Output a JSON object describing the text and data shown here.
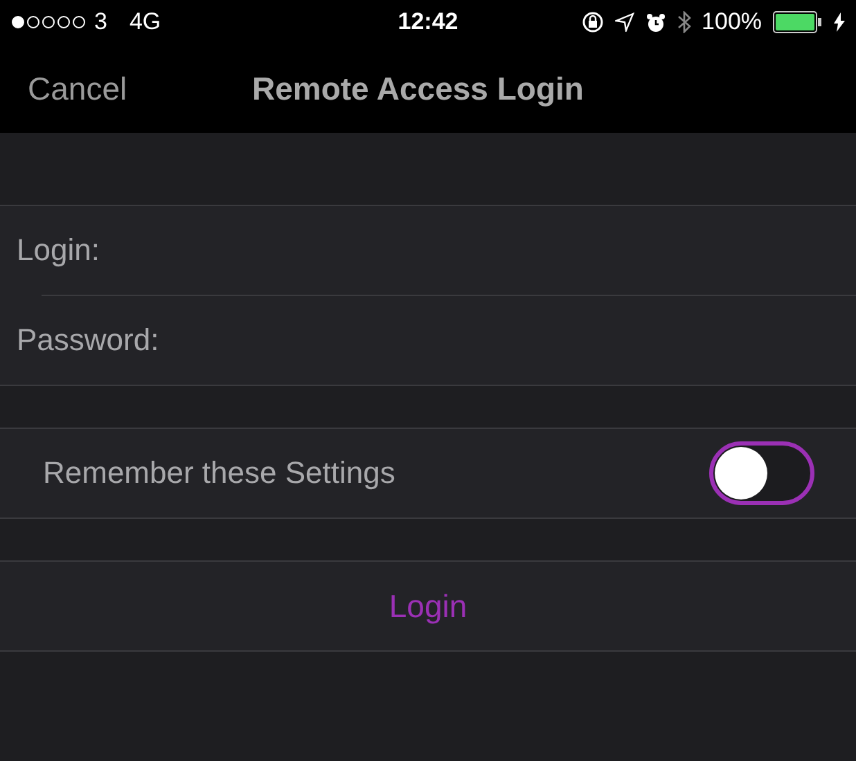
{
  "status_bar": {
    "carrier": "3",
    "network": "4G",
    "time": "12:42",
    "battery": "100%"
  },
  "nav_bar": {
    "cancel": "Cancel",
    "title": "Remote Access Login"
  },
  "fields": [
    {
      "label": "Login:"
    },
    {
      "label": "Password:"
    }
  ],
  "remember": {
    "label": "Remember these Settings",
    "on": false
  },
  "login_button": "Login"
}
